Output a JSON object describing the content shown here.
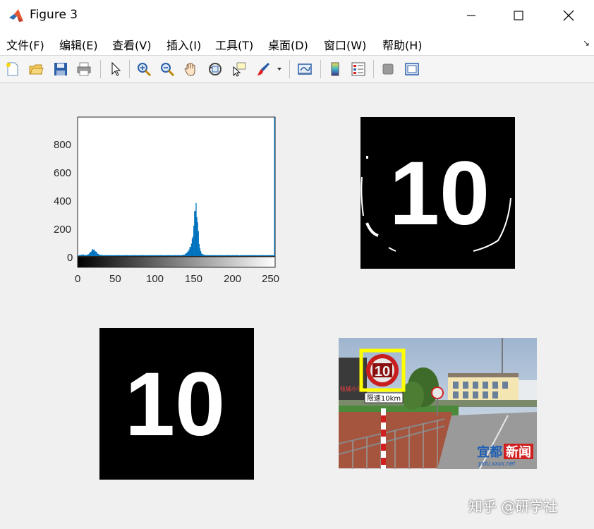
{
  "window": {
    "title": "Figure 3",
    "controls": {
      "minimize": "—",
      "maximize": "☐",
      "close": "✕"
    }
  },
  "menu": {
    "items": [
      {
        "label": "文件(F)"
      },
      {
        "label": "编辑(E)"
      },
      {
        "label": "查看(V)"
      },
      {
        "label": "插入(I)"
      },
      {
        "label": "工具(T)"
      },
      {
        "label": "桌面(D)"
      },
      {
        "label": "窗口(W)"
      },
      {
        "label": "帮助(H)"
      }
    ],
    "dock_arrow": "↘"
  },
  "toolbar": {
    "icons": [
      "new-figure-icon",
      "open-file-icon",
      "save-icon",
      "print-icon",
      "select-pointer-icon",
      "zoom-in-icon",
      "zoom-out-icon",
      "pan-hand-icon",
      "rotate-3d-icon",
      "data-cursor-icon",
      "brush-icon",
      "brush-dropdown-icon",
      "link-plot-icon",
      "colorbar-icon",
      "legend-icon",
      "hide-plot-tools-icon",
      "show-plot-tools-icon"
    ]
  },
  "histogram": {
    "y_ticks": [
      "800",
      "600",
      "400",
      "200",
      "0"
    ],
    "x_ticks": [
      "0",
      "50",
      "100",
      "150",
      "200",
      "250"
    ],
    "bar_color": "#0072bd"
  },
  "photo": {
    "sign_text": "10",
    "speed_sign_caption": "限速10km",
    "logo_part1": "宜都",
    "logo_part2": "新闻",
    "logo_url": "yidu.xxxx.net",
    "school_sign": "枝城小学",
    "highlight_color": "#ffff00"
  },
  "binary_image_1": {
    "digits": "10"
  },
  "binary_image_2": {
    "digits": "10"
  },
  "watermark": "知乎 @研学社"
}
